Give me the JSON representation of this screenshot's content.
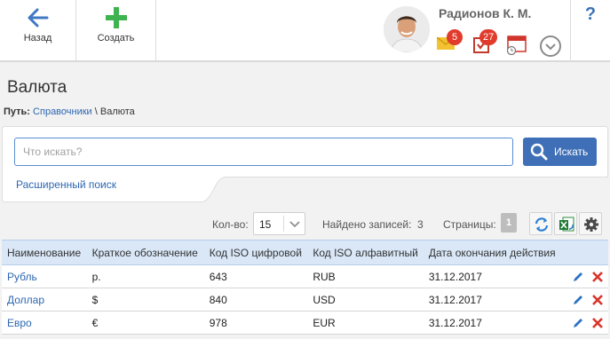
{
  "topbar": {
    "back_label": "Назад",
    "create_label": "Создать",
    "help_label": "?",
    "user_name": "Радионов К. М.",
    "mail_count": "5",
    "tasks_count": "27"
  },
  "page": {
    "title": "Валюта",
    "path_label": "Путь:",
    "path_link": "Справочники",
    "path_separator": "\\",
    "path_current": "Валюта"
  },
  "search": {
    "placeholder": "Что искать?",
    "value": "",
    "button_label": "Искать",
    "advanced_label": "Расширенный поиск"
  },
  "list_toolbar": {
    "count_label": "Кол-во:",
    "count_value": "15",
    "found_label": "Найдено записей:",
    "found_value": "3",
    "pages_label": "Страницы:",
    "current_page": "1"
  },
  "table": {
    "columns": [
      "Наименование",
      "Краткое обозначение",
      "Код ISO цифровой",
      "Код ISO алфавитный",
      "Дата окончания действия"
    ],
    "rows": [
      {
        "name": "Рубль",
        "short": "р.",
        "iso_num": "643",
        "iso_alpha": "RUB",
        "end_date": "31.12.2017"
      },
      {
        "name": "Доллар",
        "short": "$",
        "iso_num": "840",
        "iso_alpha": "USD",
        "end_date": "31.12.2017"
      },
      {
        "name": "Евро",
        "short": "€",
        "iso_num": "978",
        "iso_alpha": "EUR",
        "end_date": "31.12.2017"
      }
    ]
  },
  "colors": {
    "accent": "#3f70b7",
    "link": "#2d67b2",
    "create_green": "#3fb34f",
    "badge_red": "#e03b2b",
    "table_header": "#d9e7f7"
  },
  "icons": [
    "back-arrow-icon",
    "plus-icon",
    "mail-icon",
    "tasks-icon",
    "calendar-icon",
    "chevron-down-icon",
    "search-icon",
    "refresh-icon",
    "excel-export-icon",
    "gear-icon",
    "edit-pencil-icon",
    "delete-cross-icon"
  ]
}
